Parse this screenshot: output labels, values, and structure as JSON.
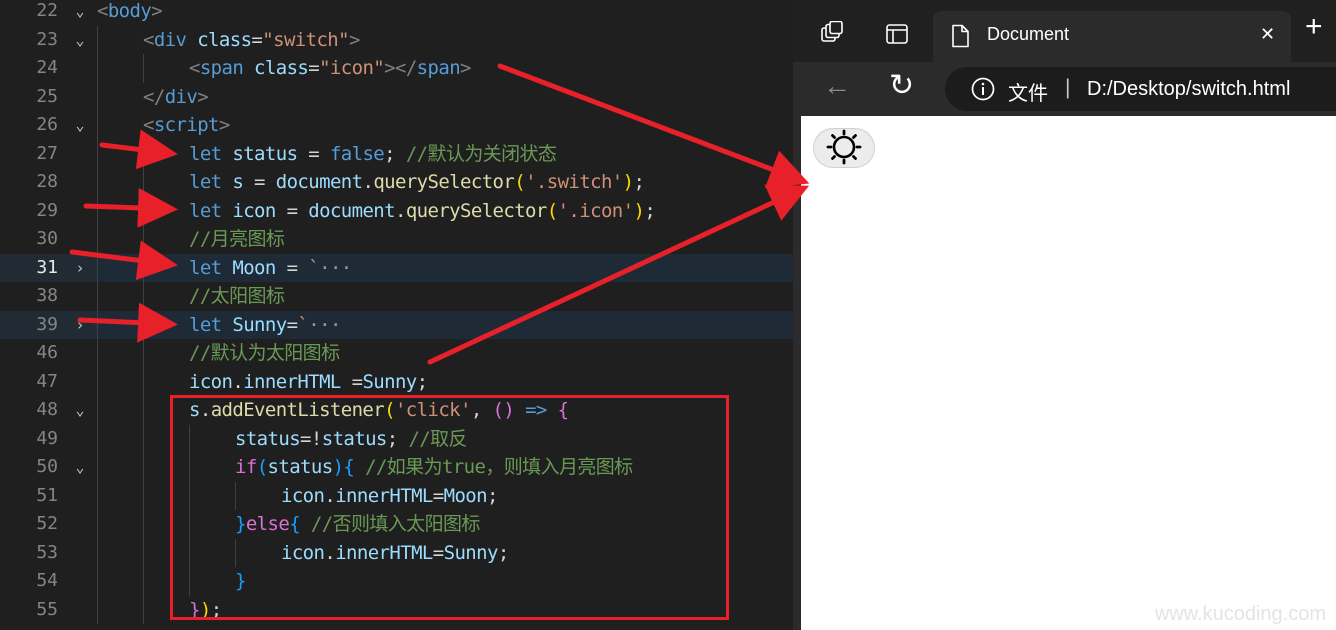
{
  "editor": {
    "lines": [
      {
        "num": "22",
        "fold": "⌄",
        "indent": 0,
        "tokens": [
          [
            "tok-punct",
            "<"
          ],
          [
            "tok-tag",
            "body"
          ],
          [
            "tok-punct",
            ">"
          ]
        ]
      },
      {
        "num": "23",
        "fold": "⌄",
        "indent": 1,
        "tokens": [
          [
            "tok-punct",
            "<"
          ],
          [
            "tok-tag",
            "div"
          ],
          [
            "tok-pl",
            " "
          ],
          [
            "tok-attr",
            "class"
          ],
          [
            "tok-pl",
            "="
          ],
          [
            "tok-str",
            "\"switch\""
          ],
          [
            "tok-punct",
            ">"
          ]
        ]
      },
      {
        "num": "24",
        "fold": "",
        "indent": 2,
        "tokens": [
          [
            "tok-punct",
            "<"
          ],
          [
            "tok-tag",
            "span"
          ],
          [
            "tok-pl",
            " "
          ],
          [
            "tok-attr",
            "class"
          ],
          [
            "tok-pl",
            "="
          ],
          [
            "tok-str",
            "\"icon\""
          ],
          [
            "tok-punct",
            "></"
          ],
          [
            "tok-tag",
            "span"
          ],
          [
            "tok-punct",
            ">"
          ]
        ]
      },
      {
        "num": "25",
        "fold": "",
        "indent": 1,
        "tokens": [
          [
            "tok-punct",
            "</"
          ],
          [
            "tok-tag",
            "div"
          ],
          [
            "tok-punct",
            ">"
          ]
        ]
      },
      {
        "num": "26",
        "fold": "⌄",
        "indent": 1,
        "tokens": [
          [
            "tok-punct",
            "<"
          ],
          [
            "tok-tag",
            "script"
          ],
          [
            "tok-punct",
            ">"
          ]
        ]
      },
      {
        "num": "27",
        "fold": "",
        "indent": 2,
        "tokens": [
          [
            "tok-kw",
            "let"
          ],
          [
            "tok-pl",
            " "
          ],
          [
            "tok-var",
            "status"
          ],
          [
            "tok-pl",
            " = "
          ],
          [
            "tok-kw",
            "false"
          ],
          [
            "tok-pl",
            "; "
          ],
          [
            "tok-cm",
            "//默认为关闭状态"
          ]
        ]
      },
      {
        "num": "28",
        "fold": "",
        "indent": 2,
        "tokens": [
          [
            "tok-kw",
            "let"
          ],
          [
            "tok-pl",
            " "
          ],
          [
            "tok-var",
            "s"
          ],
          [
            "tok-pl",
            " = "
          ],
          [
            "tok-var",
            "document"
          ],
          [
            "tok-pl",
            "."
          ],
          [
            "tok-fn",
            "querySelector"
          ],
          [
            "tok-br1",
            "("
          ],
          [
            "tok-str",
            "'.switch'"
          ],
          [
            "tok-br1",
            ")"
          ],
          [
            "tok-pl",
            ";"
          ]
        ]
      },
      {
        "num": "29",
        "fold": "",
        "indent": 2,
        "tokens": [
          [
            "tok-kw",
            "let"
          ],
          [
            "tok-pl",
            " "
          ],
          [
            "tok-var",
            "icon"
          ],
          [
            "tok-pl",
            " = "
          ],
          [
            "tok-var",
            "document"
          ],
          [
            "tok-pl",
            "."
          ],
          [
            "tok-fn",
            "querySelector"
          ],
          [
            "tok-br1",
            "("
          ],
          [
            "tok-str",
            "'.icon'"
          ],
          [
            "tok-br1",
            ")"
          ],
          [
            "tok-pl",
            ";"
          ]
        ]
      },
      {
        "num": "30",
        "fold": "",
        "indent": 2,
        "tokens": [
          [
            "tok-cm",
            "//月亮图标"
          ]
        ]
      },
      {
        "num": "31",
        "fold": "›",
        "indent": 2,
        "hl": true,
        "active": true,
        "tokens": [
          [
            "tok-kw",
            "let"
          ],
          [
            "tok-pl",
            " "
          ],
          [
            "tok-var",
            "Moon"
          ],
          [
            "tok-pl",
            " = "
          ],
          [
            "tok-str",
            "`"
          ],
          [
            "tok-ell",
            "···"
          ]
        ]
      },
      {
        "num": "38",
        "fold": "",
        "indent": 2,
        "tokens": [
          [
            "tok-cm",
            "//太阳图标"
          ]
        ]
      },
      {
        "num": "39",
        "fold": "›",
        "indent": 2,
        "hl": true,
        "tokens": [
          [
            "tok-kw",
            "let"
          ],
          [
            "tok-pl",
            " "
          ],
          [
            "tok-var",
            "Sunny"
          ],
          [
            "tok-pl",
            "="
          ],
          [
            "tok-str",
            "`"
          ],
          [
            "tok-ell",
            "···"
          ]
        ]
      },
      {
        "num": "46",
        "fold": "",
        "indent": 2,
        "tokens": [
          [
            "tok-cm",
            "//默认为太阳图标"
          ]
        ]
      },
      {
        "num": "47",
        "fold": "",
        "indent": 2,
        "tokens": [
          [
            "tok-var",
            "icon"
          ],
          [
            "tok-pl",
            "."
          ],
          [
            "tok-var",
            "innerHTML"
          ],
          [
            "tok-pl",
            " ="
          ],
          [
            "tok-var",
            "Sunny"
          ],
          [
            "tok-pl",
            ";"
          ]
        ]
      },
      {
        "num": "48",
        "fold": "⌄",
        "indent": 2,
        "tokens": [
          [
            "tok-var",
            "s"
          ],
          [
            "tok-pl",
            "."
          ],
          [
            "tok-fn",
            "addEventListener"
          ],
          [
            "tok-br1",
            "("
          ],
          [
            "tok-str",
            "'click'"
          ],
          [
            "tok-pl",
            ", "
          ],
          [
            "tok-br2",
            "()"
          ],
          [
            "tok-pl",
            " "
          ],
          [
            "tok-kw",
            "=>"
          ],
          [
            "tok-pl",
            " "
          ],
          [
            "tok-br2",
            "{"
          ]
        ]
      },
      {
        "num": "49",
        "fold": "",
        "indent": 3,
        "tokens": [
          [
            "tok-var",
            "status"
          ],
          [
            "tok-pl",
            "=!"
          ],
          [
            "tok-var",
            "status"
          ],
          [
            "tok-pl",
            "; "
          ],
          [
            "tok-cm",
            "//取反"
          ]
        ]
      },
      {
        "num": "50",
        "fold": "⌄",
        "indent": 3,
        "tokens": [
          [
            "tok-br2",
            "if"
          ],
          [
            "tok-br3",
            "("
          ],
          [
            "tok-var",
            "status"
          ],
          [
            "tok-br3",
            ")"
          ],
          [
            "tok-br3",
            "{"
          ],
          [
            "tok-pl",
            " "
          ],
          [
            "tok-cm",
            "//如果为true，则填入月亮图标"
          ]
        ]
      },
      {
        "num": "51",
        "fold": "",
        "indent": 4,
        "tokens": [
          [
            "tok-var",
            "icon"
          ],
          [
            "tok-pl",
            "."
          ],
          [
            "tok-var",
            "innerHTML"
          ],
          [
            "tok-pl",
            "="
          ],
          [
            "tok-var",
            "Moon"
          ],
          [
            "tok-pl",
            ";"
          ]
        ]
      },
      {
        "num": "52",
        "fold": "",
        "indent": 3,
        "tokens": [
          [
            "tok-br3",
            "}"
          ],
          [
            "tok-br2",
            "else"
          ],
          [
            "tok-br3",
            "{"
          ],
          [
            "tok-pl",
            " "
          ],
          [
            "tok-cm",
            "//否则填入太阳图标"
          ]
        ]
      },
      {
        "num": "53",
        "fold": "",
        "indent": 4,
        "tokens": [
          [
            "tok-var",
            "icon"
          ],
          [
            "tok-pl",
            "."
          ],
          [
            "tok-var",
            "innerHTML"
          ],
          [
            "tok-pl",
            "="
          ],
          [
            "tok-var",
            "Sunny"
          ],
          [
            "tok-pl",
            ";"
          ]
        ]
      },
      {
        "num": "54",
        "fold": "",
        "indent": 3,
        "tokens": [
          [
            "tok-br3",
            "}"
          ]
        ]
      },
      {
        "num": "55",
        "fold": "",
        "indent": 2,
        "tokens": [
          [
            "tok-br2",
            "}"
          ],
          [
            "tok-br1",
            ")"
          ],
          [
            "tok-pl",
            ";"
          ]
        ]
      }
    ]
  },
  "browser": {
    "tab_title": "Document",
    "tab_close": "✕",
    "new_tab": "+",
    "back": "←",
    "reload": "↻",
    "info": "i",
    "file_label": "文件",
    "separator": "|",
    "url": "D:/Desktop/switch.html",
    "colors": {
      "chrome_dark": "#202020",
      "chrome_mid": "#2b2b2b",
      "page": "#ffffff"
    }
  },
  "watermark": "www.kucoding.com",
  "annotation_color": "#e8202a"
}
